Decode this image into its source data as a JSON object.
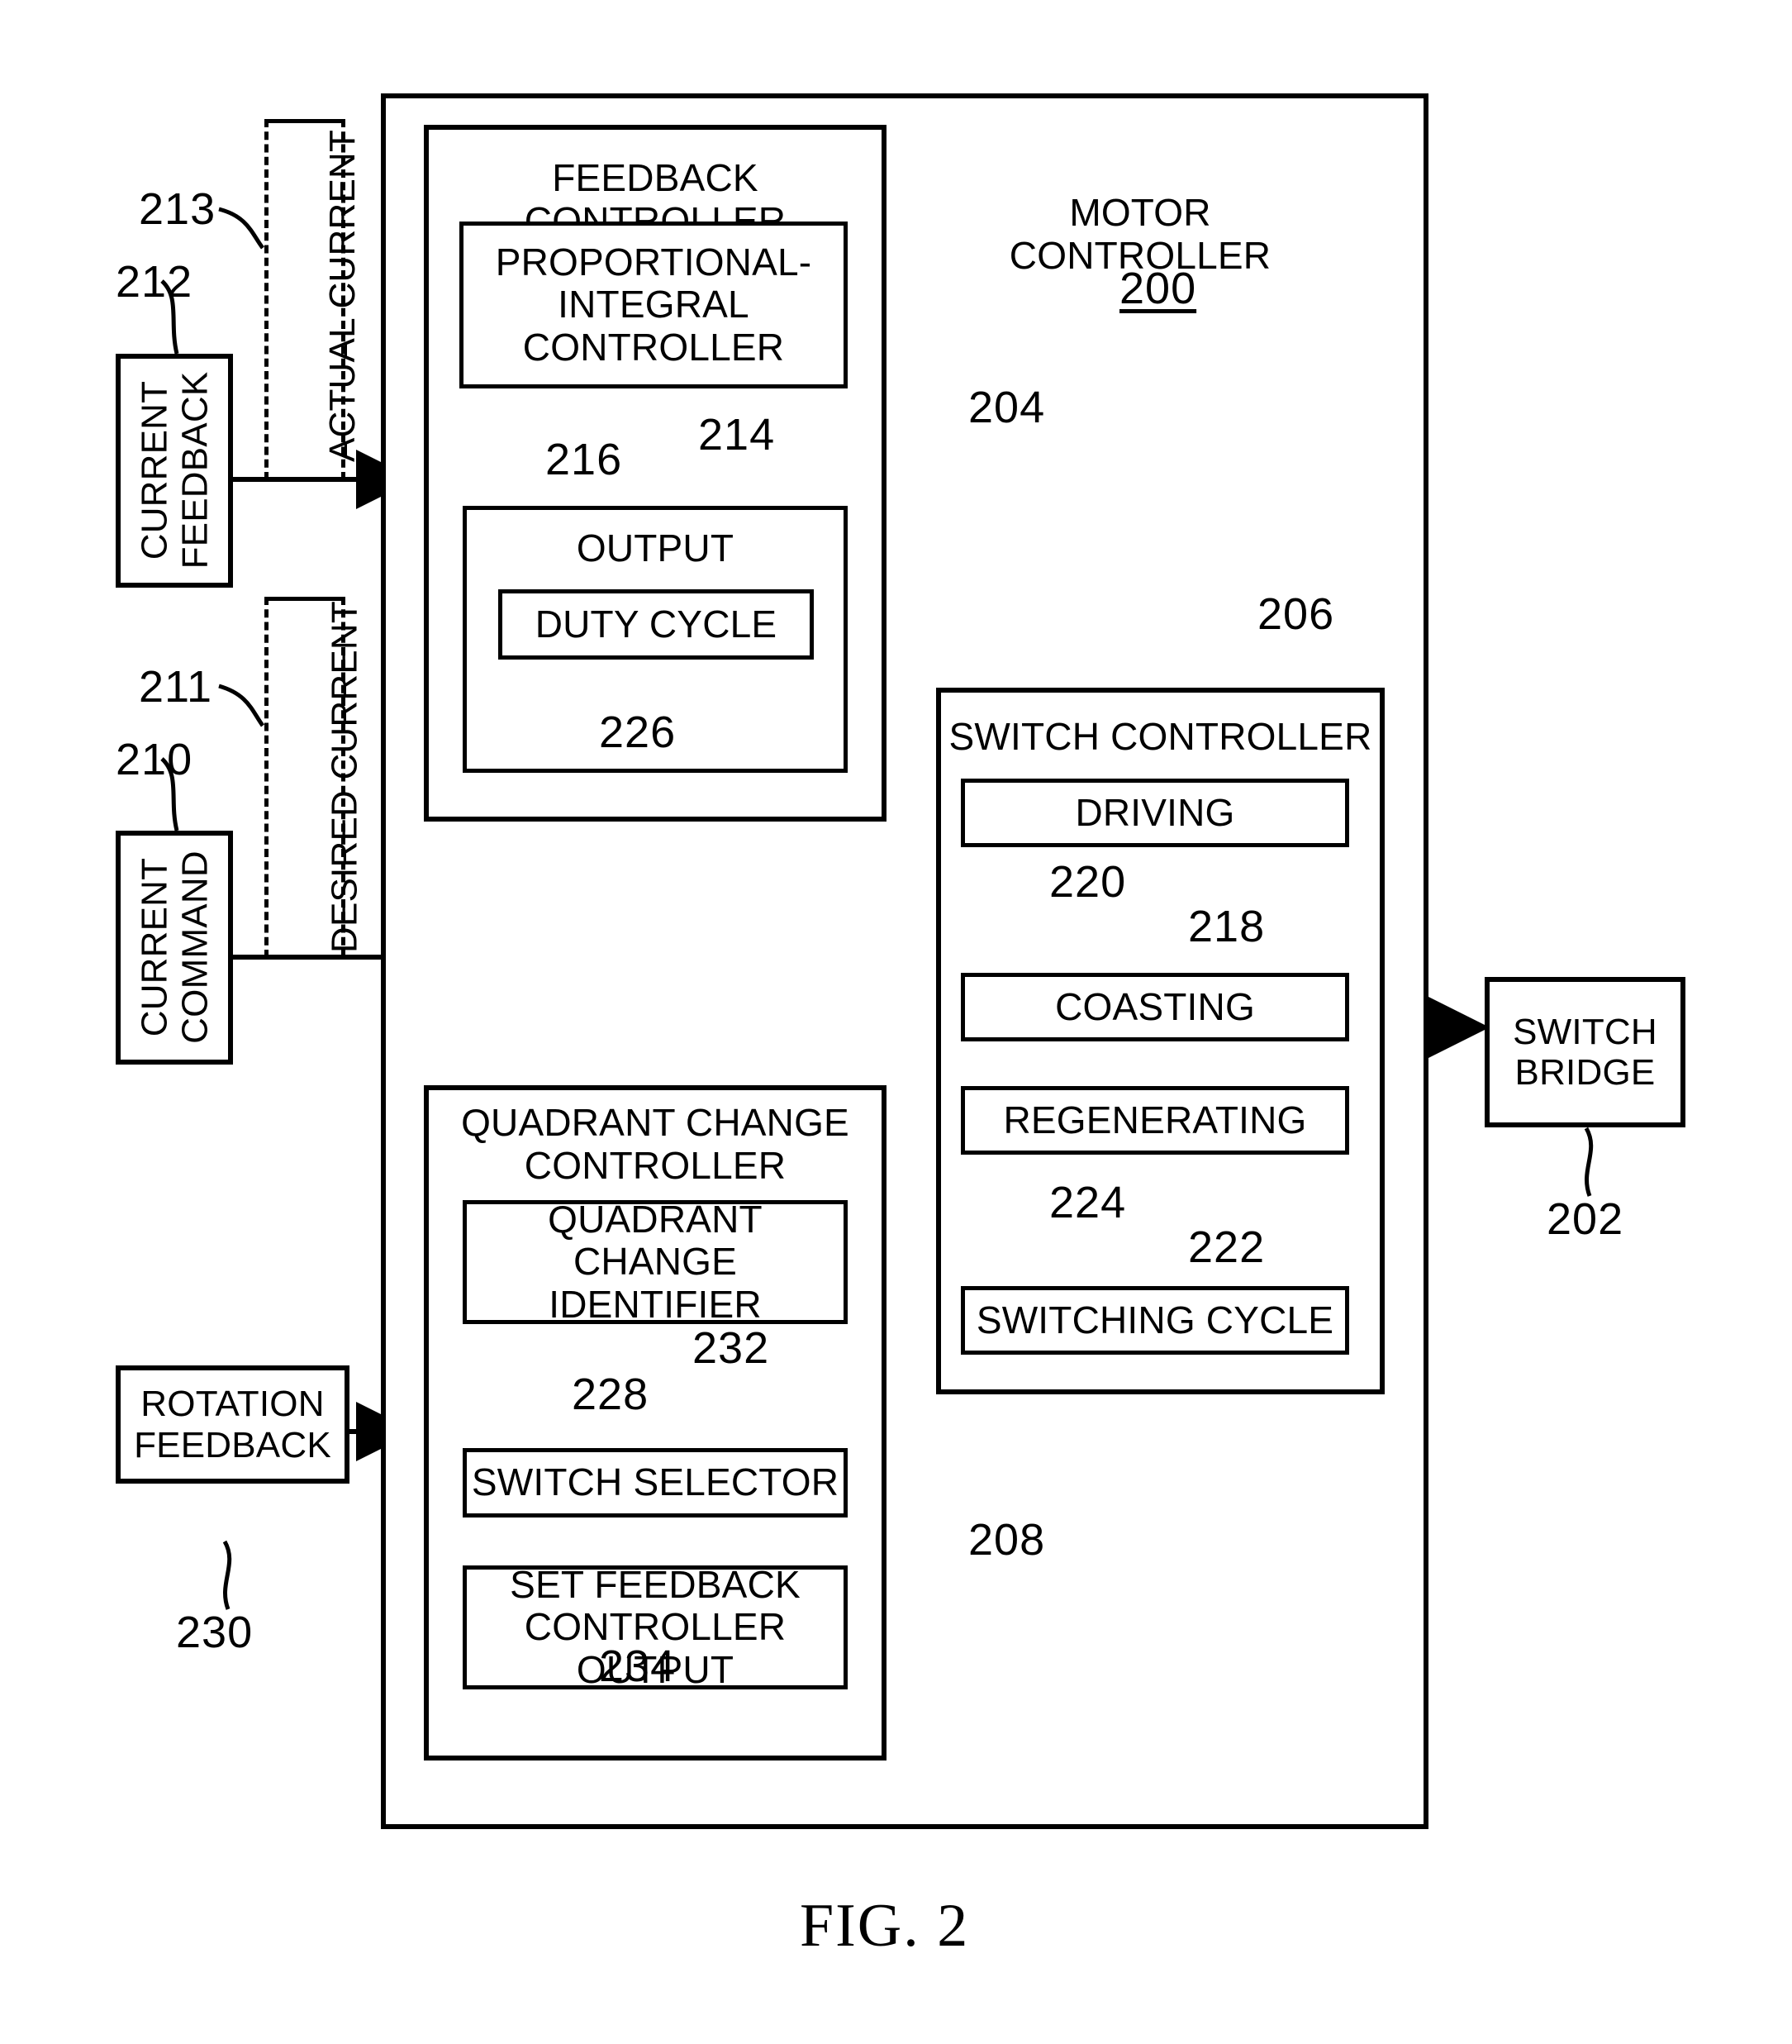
{
  "figure": {
    "caption": "FIG. 2",
    "title": "MOTOR CONTROLLER",
    "title_ref": "200"
  },
  "external_blocks": [
    {
      "id": "current_feedback",
      "label": "CURRENT\nFEEDBACK",
      "ref": "212",
      "orientation": "vertical"
    },
    {
      "id": "current_command",
      "label": "CURRENT\nCOMMAND",
      "ref": "210",
      "orientation": "vertical"
    },
    {
      "id": "rotation_feedback",
      "label": "ROTATION\nFEEDBACK",
      "ref": "230",
      "orientation": "horizontal"
    },
    {
      "id": "switch_bridge",
      "label": "SWITCH\nBRIDGE",
      "ref": "202",
      "orientation": "horizontal"
    }
  ],
  "signals": [
    {
      "id": "actual_current",
      "label": "ACTUAL CURRENT",
      "ref": "213"
    },
    {
      "id": "desired_current",
      "label": "DESIRED CURRENT",
      "ref": "211"
    }
  ],
  "feedback_controller": {
    "title": "FEEDBACK CONTROLLER",
    "ref": "204",
    "children": [
      {
        "id": "pi_controller",
        "label": "PROPORTIONAL-\nINTEGRAL\nCONTROLLER",
        "ref": "216"
      },
      {
        "id": "output",
        "label": "OUTPUT",
        "ref": "214",
        "children": [
          {
            "id": "duty_cycle",
            "label": "DUTY CYCLE",
            "ref": "226"
          }
        ]
      }
    ]
  },
  "switch_controller": {
    "title": "SWITCH CONTROLLER",
    "ref": "206",
    "children": [
      {
        "id": "driving",
        "label": "DRIVING",
        "ref": "218"
      },
      {
        "id": "coasting",
        "label": "COASTING",
        "ref": "220"
      },
      {
        "id": "regenerating",
        "label": "REGENERATING",
        "ref": "222"
      },
      {
        "id": "switching_cycle",
        "label": "SWITCHING CYCLE",
        "ref": "224"
      }
    ]
  },
  "quadrant_change_controller": {
    "title": "QUADRANT CHANGE\nCONTROLLER",
    "ref": "208",
    "children": [
      {
        "id": "quadrant_change_identifier",
        "label": "QUADRANT CHANGE\nIDENTIFIER",
        "ref": "228"
      },
      {
        "id": "switch_selector",
        "label": "SWITCH SELECTOR",
        "ref": "232"
      },
      {
        "id": "set_feedback_controller_output",
        "label": "SET FEEDBACK\nCONTROLLER OUTPUT",
        "ref": "234"
      }
    ]
  }
}
